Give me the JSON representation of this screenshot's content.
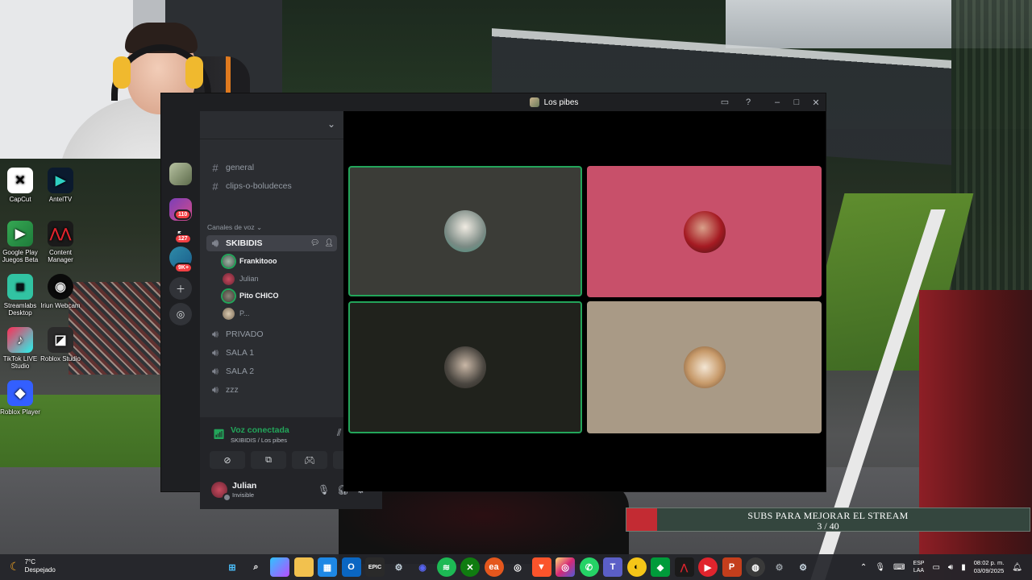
{
  "discord": {
    "window_title": "Los pibes",
    "server_badges": [
      "110",
      "127",
      "9K+"
    ],
    "channels": {
      "text": [
        "general",
        "clips-o-boludeces"
      ],
      "voice_category": "Canales de voz",
      "active_voice": "SKIBIDIS",
      "voice_users": [
        "Frankitooo",
        "Julian",
        "Pito CHICO",
        "P..."
      ],
      "other_voice": [
        "PRIVADO",
        "SALA 1",
        "SALA 2",
        "zzz"
      ]
    },
    "voice_panel": {
      "status": "Voz conectada",
      "location": "SKIBIDIS / Los pibes"
    },
    "user": {
      "name": "Julian",
      "status": "Invisible"
    },
    "colors": {
      "online": "#23a55a",
      "badge": "#f23f43",
      "tile_pink": "#c8506a",
      "tile_beige": "#a99a86",
      "tile_gray": "#3b3c37",
      "tile_dark": "#20221c"
    }
  },
  "desktop_icons": [
    {
      "label": "CapCut",
      "icon": "capcut-icon"
    },
    {
      "label": "AntelTV",
      "icon": "anteltv-icon"
    },
    {
      "label": "Google Play Juegos Beta",
      "icon": "google-play-games-icon"
    },
    {
      "label": "Content Manager",
      "icon": "content-manager-icon"
    },
    {
      "label": "Streamlabs Desktop",
      "icon": "streamlabs-icon"
    },
    {
      "label": "Iriun Webcam",
      "icon": "iriun-webcam-icon"
    },
    {
      "label": "TikTok LIVE Studio",
      "icon": "tiktok-live-icon"
    },
    {
      "label": "Roblox Studio",
      "icon": "roblox-studio-icon"
    },
    {
      "label": "Roblox Player",
      "icon": "roblox-player-icon"
    }
  ],
  "subs_goal": {
    "title": "SUBS PARA MEJORAR EL STREAM",
    "current": 3,
    "target": 40,
    "text": "3 / 40"
  },
  "taskbar": {
    "weather_temp": "7°C",
    "weather_desc": "Despejado",
    "lang": "ESP",
    "layout": "LAA",
    "time": "08:02 p. m.",
    "date": "03/09/2025"
  }
}
